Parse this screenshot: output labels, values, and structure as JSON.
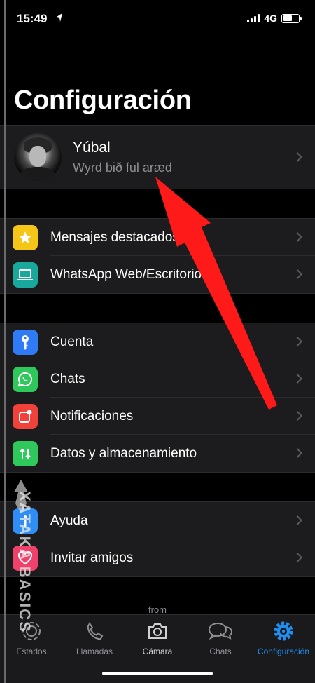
{
  "status_bar": {
    "time": "15:49",
    "network": "4G"
  },
  "page": {
    "title": "Configuración"
  },
  "profile": {
    "name": "Yúbal",
    "status": "Wyrd bið ful aræd"
  },
  "group1": [
    {
      "label": "Mensajes destacados",
      "icon": "star-icon",
      "color": "#f5c518"
    },
    {
      "label": "WhatsApp Web/Escritorio",
      "icon": "laptop-icon",
      "color": "#19a89c"
    }
  ],
  "group2": [
    {
      "label": "Cuenta",
      "icon": "key-icon",
      "color": "#2f7bf5"
    },
    {
      "label": "Chats",
      "icon": "whatsapp-icon",
      "color": "#2fc85a"
    },
    {
      "label": "Notificaciones",
      "icon": "notification-icon",
      "color": "#f0413a"
    },
    {
      "label": "Datos y almacenamiento",
      "icon": "arrows-updown-icon",
      "color": "#2fc85a"
    }
  ],
  "group3": [
    {
      "label": "Ayuda",
      "icon": "info-icon",
      "color": "#2f8df5"
    },
    {
      "label": "Invitar amigos",
      "icon": "heart-icon",
      "color": "#f0416a"
    }
  ],
  "tab_bar": {
    "from_text": "from",
    "tabs": [
      {
        "label": "Estados",
        "icon": "status-icon"
      },
      {
        "label": "Llamadas",
        "icon": "phone-icon"
      },
      {
        "label": "Cámara",
        "icon": "camera-icon"
      },
      {
        "label": "Chats",
        "icon": "chats-icon"
      },
      {
        "label": "Configuración",
        "icon": "gear-icon",
        "active": true
      }
    ]
  },
  "watermark": {
    "text": "XATAKA BASICS"
  },
  "colors": {
    "accent": "#1e8ef0",
    "arrow": "#ff1a1a",
    "background": "#000000",
    "row_bg": "#1c1c1e"
  }
}
